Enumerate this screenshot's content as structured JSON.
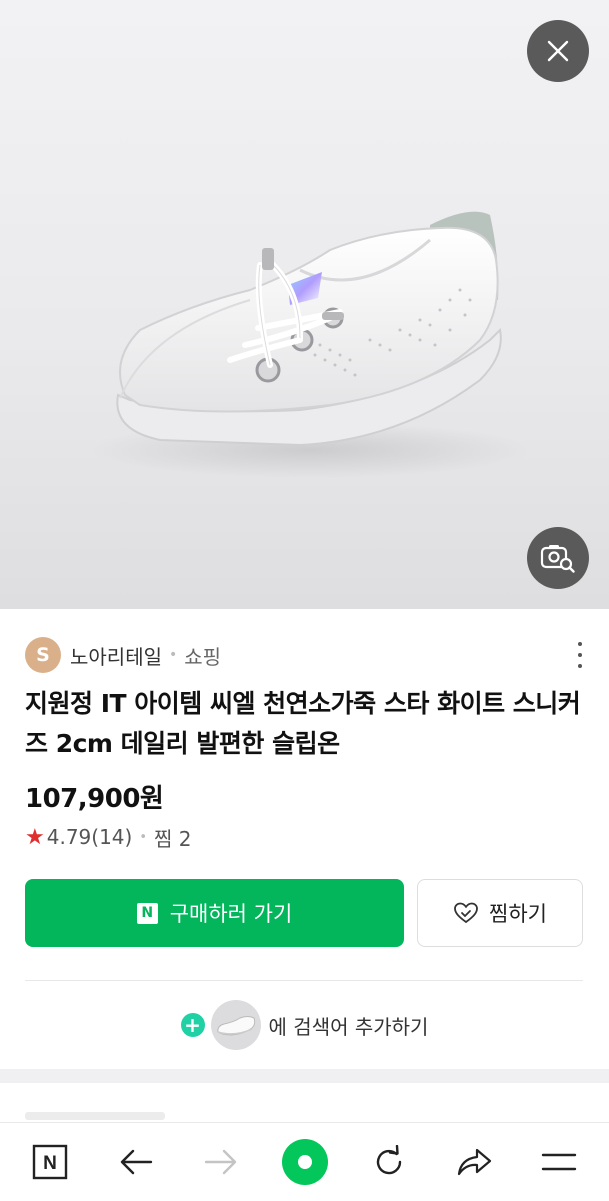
{
  "seller": {
    "avatar_letter": "S",
    "name": "노아리테일",
    "category": "쇼핑"
  },
  "product": {
    "title": "지원정 IT 아이템 씨엘 천연소가죽 스타 화이트 스니커즈 2cm 데일리 발편한 슬립온",
    "price": "107,900원",
    "rating": "4.79",
    "review_count": "(14)",
    "wish_count": "찜 2"
  },
  "actions": {
    "buy_badge": "N",
    "buy_label": "구매하러 가기",
    "wish_label": "찜하기",
    "add_keyword_label": "에 검색어 추가하기"
  },
  "bottom_nav": {
    "home_letter": "N"
  },
  "icons": [
    "close-icon",
    "image-search-icon",
    "more-vertical-icon",
    "star-icon",
    "heart-icon",
    "plus-icon",
    "back-icon",
    "forward-icon",
    "home-dot-icon",
    "refresh-icon",
    "share-icon",
    "menu-icon"
  ],
  "colors": {
    "accent": "#03b55b",
    "star": "#e02d2d",
    "keyword_plus": "#1fd1a5",
    "avatar": "#d9b089"
  }
}
